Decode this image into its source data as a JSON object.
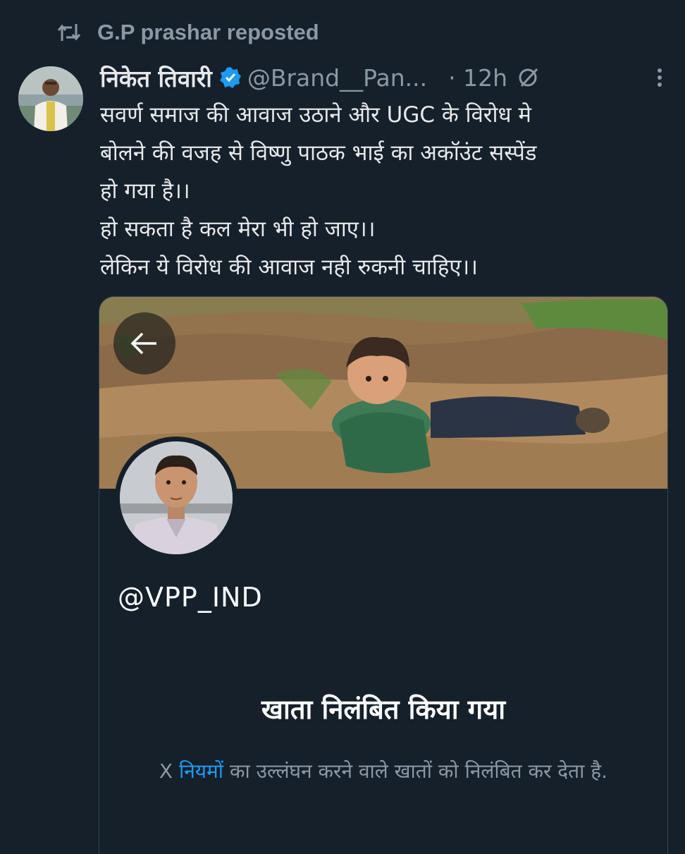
{
  "repost": {
    "label": "G.P prashar reposted"
  },
  "tweet": {
    "author_name": "निकेत तिवारी",
    "handle": "@Brand__Pan...",
    "time": "· 12h",
    "text": "सवर्ण समाज की आवाज उठाने और UGC के विरोध मे\nबोलने की वजह से विष्णु पाठक भाई का अकॉउंट सस्पेंड\nहो गया है।।\nहो सकता है कल मेरा भी हो जाए।।\nलेकिन ये विरोध की आवाज नही रुकनी चाहिए।।"
  },
  "card": {
    "handle": "@VPP_IND",
    "title": "खाता निलंबित किया गया",
    "desc_prefix": "X ",
    "desc_link": "नियमों",
    "desc_suffix": " का उल्लंघन करने वाले खातों को निलंबित कर देता है."
  },
  "colors": {
    "background": "#15202b",
    "secondary_text": "#8b98a5",
    "link": "#1d9bf0",
    "verified": "#1d9bf0"
  },
  "icons": [
    "repost-icon",
    "verified-badge-icon",
    "grok-icon",
    "more-options-icon",
    "back-arrow-icon"
  ]
}
